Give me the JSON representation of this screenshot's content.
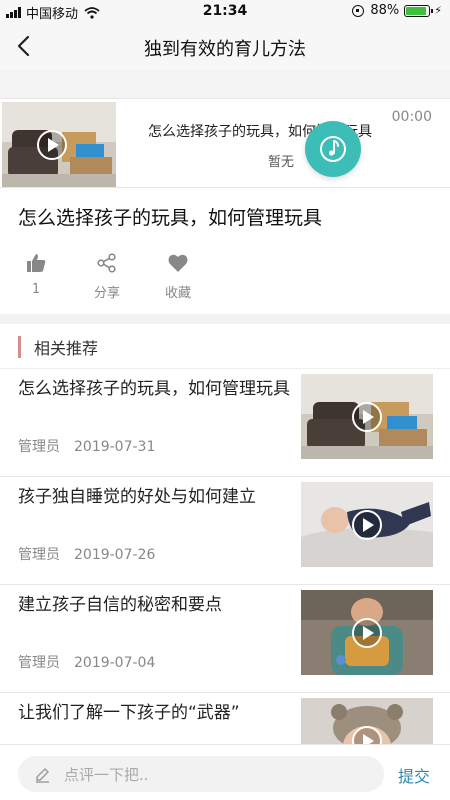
{
  "status_bar": {
    "carrier": "中国移动",
    "time": "21:34",
    "battery": "88%",
    "battery_level": 0.88
  },
  "nav": {
    "title": "独到有效的育儿方法"
  },
  "player": {
    "title": "怎么选择孩子的玩具，如何管理玩具",
    "time": "00:00",
    "status": "暂无"
  },
  "article": {
    "title": "怎么选择孩子的玩具，如何管理玩具"
  },
  "actions": {
    "like_count": "1",
    "share_label": "分享",
    "favorite_label": "收藏"
  },
  "section": {
    "title": "相关推荐"
  },
  "recommendations": [
    {
      "title": "怎么选择孩子的玩具，如何管理玩具",
      "author": "管理员",
      "date": "2019-07-31"
    },
    {
      "title": "孩子独自睡觉的好处与如何建立",
      "author": "管理员",
      "date": "2019-07-26"
    },
    {
      "title": "建立孩子自信的秘密和要点",
      "author": "管理员",
      "date": "2019-07-04"
    },
    {
      "title": "让我们了解一下孩子的“武器”",
      "author": "",
      "date": ""
    }
  ],
  "comment": {
    "placeholder": "点评一下把..",
    "submit_label": "提交"
  },
  "colors": {
    "accent_teal": "#3dbdb8",
    "section_bar": "#d98c8c",
    "submit_blue": "#2d8ab0"
  }
}
